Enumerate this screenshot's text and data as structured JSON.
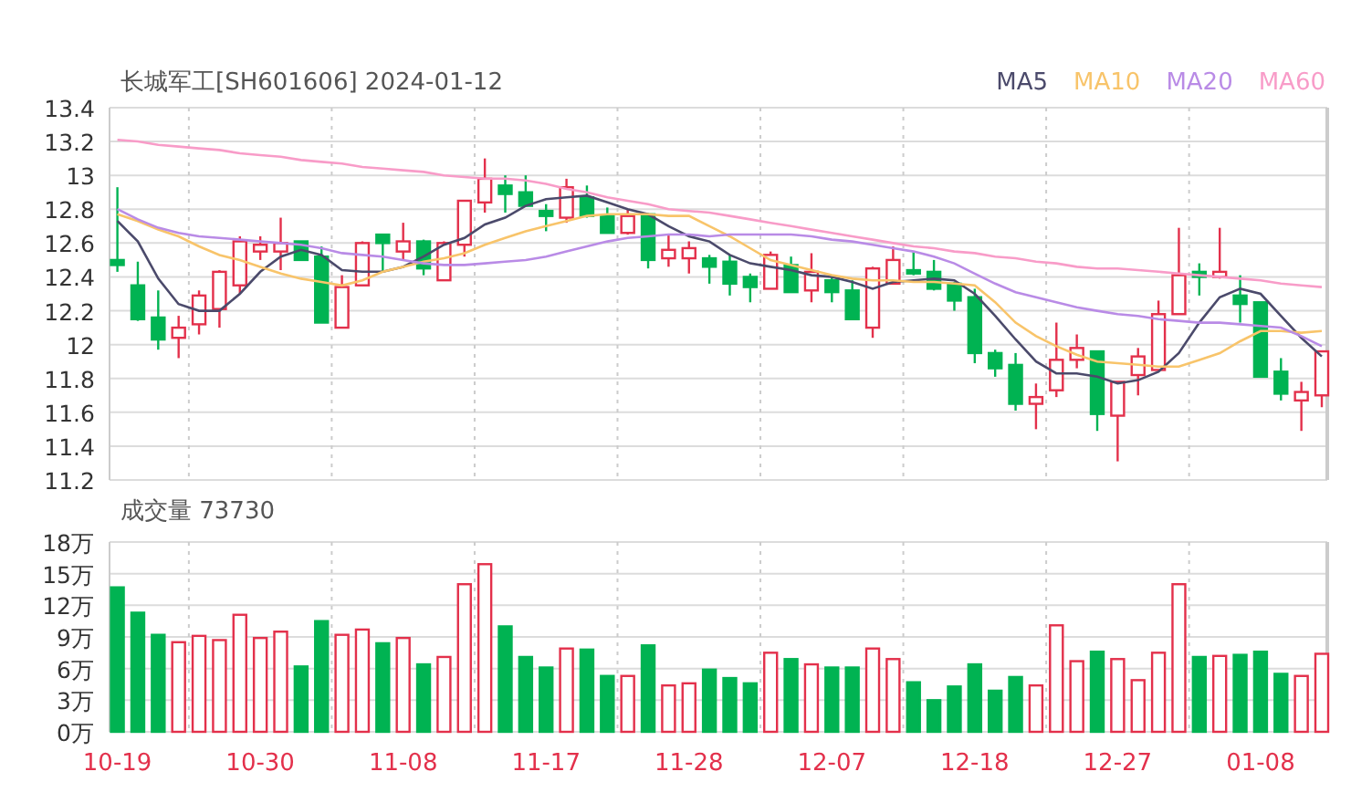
{
  "price_chart": {
    "chart_data": {
      "type": "candlestick",
      "title": "长城军工[SH601606] 2024-01-12",
      "ylim": [
        11.2,
        13.4
      ],
      "grid": true,
      "yticks": [
        11.2,
        11.4,
        11.6,
        11.8,
        12,
        12.2,
        12.4,
        12.6,
        12.8,
        13,
        13.2,
        13.4
      ],
      "categories": [
        null,
        null,
        null,
        null,
        null,
        null,
        null,
        null,
        null,
        null,
        null,
        null,
        null,
        null,
        null,
        null,
        null,
        null,
        null,
        null,
        null,
        null,
        null,
        null,
        null,
        null,
        null,
        null,
        null,
        null,
        null,
        null,
        null,
        null,
        null,
        null,
        null,
        null,
        null,
        null,
        null,
        null,
        null,
        null,
        null,
        null,
        null,
        null,
        null,
        null,
        null,
        null,
        null,
        null,
        null,
        null,
        null,
        null,
        null,
        null
      ],
      "ohlc": [
        [
          12.5,
          12.93,
          12.43,
          12.47
        ],
        [
          12.35,
          12.49,
          12.14,
          12.15
        ],
        [
          12.16,
          12.32,
          11.97,
          12.03
        ],
        [
          12.04,
          12.17,
          11.92,
          12.1
        ],
        [
          12.12,
          12.32,
          12.06,
          12.29
        ],
        [
          12.21,
          12.44,
          12.1,
          12.43
        ],
        [
          12.35,
          12.64,
          12.3,
          12.61
        ],
        [
          12.55,
          12.64,
          12.5,
          12.59
        ],
        [
          12.55,
          12.75,
          12.44,
          12.6
        ],
        [
          12.61,
          12.61,
          12.5,
          12.5
        ],
        [
          12.52,
          12.58,
          12.13,
          12.13
        ],
        [
          12.1,
          12.41,
          12.1,
          12.34
        ],
        [
          12.35,
          12.61,
          12.35,
          12.6
        ],
        [
          12.65,
          12.65,
          12.43,
          12.6
        ],
        [
          12.55,
          12.72,
          12.5,
          12.61
        ],
        [
          12.61,
          12.62,
          12.41,
          12.45
        ],
        [
          12.38,
          12.61,
          12.38,
          12.6
        ],
        [
          12.59,
          12.85,
          12.52,
          12.85
        ],
        [
          12.84,
          13.1,
          12.78,
          12.98
        ],
        [
          12.94,
          13.0,
          12.78,
          12.89
        ],
        [
          12.9,
          13.0,
          12.82,
          12.82
        ],
        [
          12.79,
          12.83,
          12.67,
          12.76
        ],
        [
          12.75,
          12.98,
          12.72,
          12.93
        ],
        [
          12.87,
          12.94,
          12.75,
          12.76
        ],
        [
          12.76,
          12.81,
          12.66,
          12.66
        ],
        [
          12.66,
          12.8,
          12.65,
          12.76
        ],
        [
          12.77,
          12.77,
          12.45,
          12.5
        ],
        [
          12.51,
          12.65,
          12.46,
          12.56
        ],
        [
          12.51,
          12.61,
          12.42,
          12.57
        ],
        [
          12.51,
          12.53,
          12.36,
          12.46
        ],
        [
          12.49,
          12.53,
          12.29,
          12.36
        ],
        [
          12.4,
          12.42,
          12.25,
          12.34
        ],
        [
          12.33,
          12.55,
          12.33,
          12.53
        ],
        [
          12.47,
          12.52,
          12.31,
          12.31
        ],
        [
          12.32,
          12.54,
          12.25,
          12.43
        ],
        [
          12.38,
          12.41,
          12.25,
          12.31
        ],
        [
          12.32,
          12.38,
          12.15,
          12.15
        ],
        [
          12.1,
          12.46,
          12.04,
          12.45
        ],
        [
          12.36,
          12.58,
          12.36,
          12.5
        ],
        [
          12.44,
          12.55,
          12.41,
          12.42
        ],
        [
          12.43,
          12.5,
          12.32,
          12.33
        ],
        [
          12.36,
          12.37,
          12.2,
          12.26
        ],
        [
          12.28,
          12.33,
          11.89,
          11.95
        ],
        [
          11.95,
          11.97,
          11.81,
          11.86
        ],
        [
          11.88,
          11.95,
          11.61,
          11.65
        ],
        [
          11.65,
          11.77,
          11.5,
          11.69
        ],
        [
          11.73,
          12.13,
          11.69,
          11.91
        ],
        [
          11.91,
          12.06,
          11.86,
          11.98
        ],
        [
          11.96,
          11.96,
          11.49,
          11.59
        ],
        [
          11.58,
          11.78,
          11.31,
          11.78
        ],
        [
          11.82,
          11.98,
          11.7,
          11.93
        ],
        [
          11.85,
          12.26,
          11.85,
          12.18
        ],
        [
          12.18,
          12.69,
          12.18,
          12.41
        ],
        [
          12.43,
          12.48,
          12.29,
          12.4
        ],
        [
          12.4,
          12.69,
          12.39,
          12.43
        ],
        [
          12.29,
          12.41,
          12.13,
          12.24
        ],
        [
          12.25,
          12.25,
          11.81,
          11.81
        ],
        [
          11.84,
          11.92,
          11.67,
          11.71
        ],
        [
          11.67,
          11.78,
          11.49,
          11.72
        ],
        [
          11.7,
          11.96,
          11.63,
          11.96
        ]
      ],
      "series": [
        {
          "name": "MA5",
          "type": "line",
          "color": "#4b4a6b",
          "values": [
            12.73,
            12.61,
            12.39,
            12.24,
            12.2,
            12.2,
            12.3,
            12.43,
            12.52,
            12.56,
            12.53,
            12.44,
            12.43,
            12.43,
            12.46,
            12.52,
            12.59,
            12.63,
            12.71,
            12.75,
            12.82,
            12.86,
            12.87,
            12.88,
            12.84,
            12.8,
            12.77,
            12.7,
            12.64,
            12.61,
            12.53,
            12.48,
            12.46,
            12.44,
            12.41,
            12.4,
            12.37,
            12.33,
            12.37,
            12.38,
            12.39,
            12.38,
            12.3,
            12.17,
            12.03,
            11.9,
            11.83,
            11.83,
            11.81,
            11.77,
            11.79,
            11.84,
            11.95,
            12.13,
            12.28,
            12.33,
            12.3,
            12.17,
            12.04,
            11.93
          ]
        },
        {
          "name": "MA10",
          "type": "line",
          "color": "#f8c46a",
          "values": [
            12.77,
            12.73,
            12.68,
            12.64,
            12.58,
            12.53,
            12.5,
            12.46,
            12.42,
            12.39,
            12.37,
            12.35,
            12.38,
            12.43,
            12.46,
            12.49,
            12.51,
            12.54,
            12.59,
            12.63,
            12.67,
            12.7,
            12.73,
            12.76,
            12.77,
            12.77,
            12.77,
            12.76,
            12.76,
            12.7,
            12.64,
            12.57,
            12.5,
            12.47,
            12.44,
            12.41,
            12.39,
            12.38,
            12.38,
            12.37,
            12.37,
            12.36,
            12.35,
            12.25,
            12.13,
            12.05,
            11.99,
            11.94,
            11.9,
            11.89,
            11.88,
            11.87,
            11.87,
            11.91,
            11.95,
            12.02,
            12.08,
            12.08,
            12.07,
            12.08
          ]
        },
        {
          "name": "MA20",
          "type": "line",
          "color": "#b98be6",
          "values": [
            12.8,
            12.74,
            12.69,
            12.66,
            12.64,
            12.63,
            12.62,
            12.61,
            12.6,
            12.59,
            12.57,
            12.54,
            12.53,
            12.52,
            12.5,
            12.48,
            12.47,
            12.47,
            12.48,
            12.49,
            12.5,
            12.52,
            12.55,
            12.58,
            12.61,
            12.63,
            12.64,
            12.65,
            12.65,
            12.64,
            12.65,
            12.65,
            12.65,
            12.65,
            12.64,
            12.62,
            12.61,
            12.59,
            12.57,
            12.55,
            12.52,
            12.48,
            12.42,
            12.36,
            12.31,
            12.28,
            12.25,
            12.22,
            12.2,
            12.18,
            12.17,
            12.15,
            12.14,
            12.13,
            12.13,
            12.12,
            12.11,
            12.1,
            12.05,
            11.99
          ]
        },
        {
          "name": "MA60",
          "type": "line",
          "color": "#f89cc8",
          "values": [
            13.21,
            13.2,
            13.18,
            13.17,
            13.16,
            13.15,
            13.13,
            13.12,
            13.11,
            13.09,
            13.08,
            13.07,
            13.05,
            13.04,
            13.03,
            13.02,
            13.0,
            12.99,
            12.98,
            12.98,
            12.97,
            12.95,
            12.92,
            12.9,
            12.87,
            12.85,
            12.83,
            12.8,
            12.79,
            12.78,
            12.76,
            12.74,
            12.72,
            12.7,
            12.68,
            12.66,
            12.64,
            12.62,
            12.6,
            12.58,
            12.57,
            12.55,
            12.54,
            12.52,
            12.51,
            12.49,
            12.48,
            12.46,
            12.45,
            12.45,
            12.44,
            12.43,
            12.42,
            12.41,
            12.4,
            12.39,
            12.38,
            12.36,
            12.35,
            12.34
          ]
        }
      ]
    }
  },
  "volume_chart": {
    "chart_data": {
      "type": "bar",
      "title": "成交量 73730",
      "ylim": [
        0,
        18
      ],
      "grid": true,
      "categories": [
        "10-19",
        null,
        null,
        null,
        null,
        null,
        null,
        "10-30",
        null,
        null,
        null,
        null,
        null,
        null,
        "11-08",
        null,
        null,
        null,
        null,
        null,
        null,
        "11-17",
        null,
        null,
        null,
        null,
        null,
        null,
        "11-28",
        null,
        null,
        null,
        null,
        null,
        null,
        "12-07",
        null,
        null,
        null,
        null,
        null,
        null,
        "12-18",
        null,
        null,
        null,
        null,
        null,
        null,
        "12-27",
        null,
        null,
        null,
        null,
        null,
        null,
        "01-08",
        null,
        null,
        null
      ],
      "yticks": [
        {
          "value": 0,
          "label": "0万"
        },
        {
          "value": 3,
          "label": "3万"
        },
        {
          "value": 6,
          "label": "6万"
        },
        {
          "value": 9,
          "label": "9万"
        },
        {
          "value": 12,
          "label": "12万"
        },
        {
          "value": 15,
          "label": "15万"
        },
        {
          "value": 18,
          "label": "18万"
        }
      ],
      "values": [
        13.7,
        11.3,
        9.2,
        8.5,
        9.1,
        8.7,
        11.1,
        8.9,
        9.5,
        6.2,
        10.5,
        9.2,
        9.7,
        8.4,
        8.9,
        6.4,
        7.1,
        14.0,
        15.9,
        10.0,
        7.1,
        6.1,
        7.9,
        7.8,
        5.3,
        5.3,
        8.2,
        4.4,
        4.6,
        5.9,
        5.1,
        4.6,
        7.5,
        6.9,
        6.4,
        6.1,
        6.1,
        7.9,
        6.9,
        4.7,
        3.0,
        4.3,
        6.4,
        3.9,
        5.2,
        4.4,
        10.1,
        6.7,
        7.6,
        6.9,
        4.9,
        7.5,
        14.0,
        7.1,
        7.2,
        7.3,
        7.6,
        5.5,
        5.3,
        7.4
      ]
    }
  }
}
